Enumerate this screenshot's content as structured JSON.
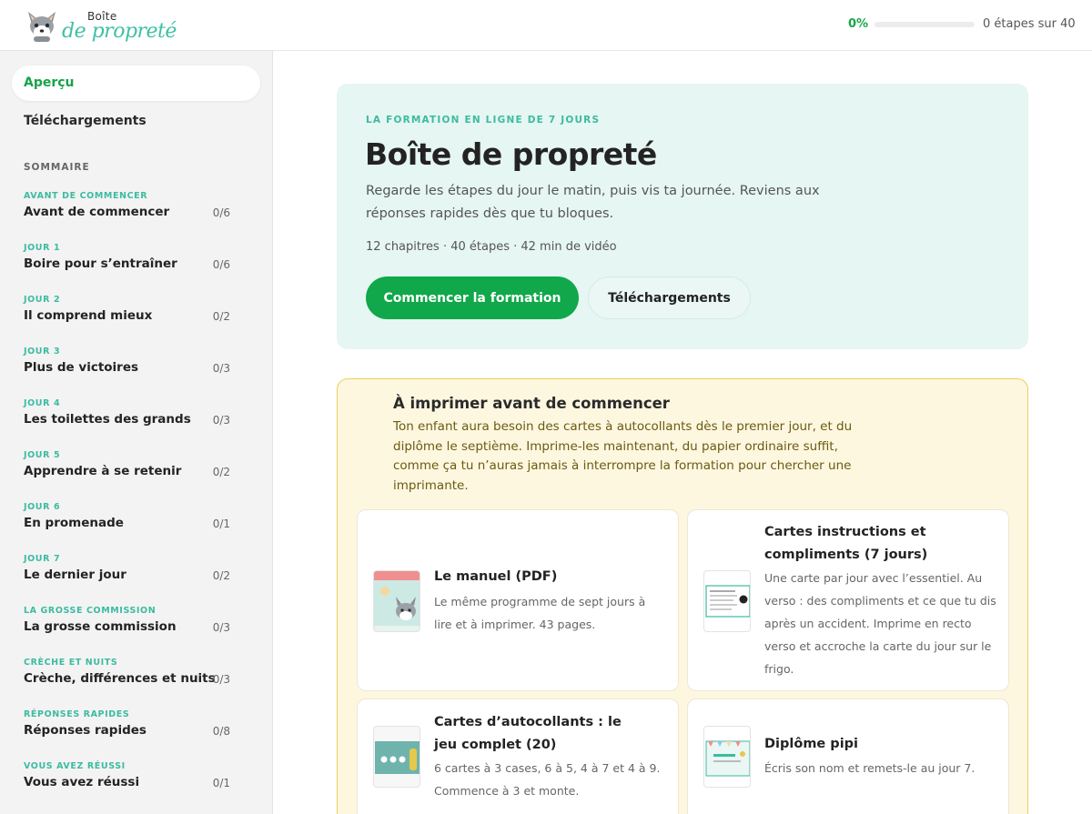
{
  "header": {
    "logo_small": "Boîte",
    "logo_big": "de propreté",
    "progress_percent": "0%",
    "progress_fraction": 0,
    "progress_text": "0 étapes sur 40"
  },
  "sidebar": {
    "active_item": "Aperçu",
    "downloads_link": "Téléchargements",
    "sommaire_label": "SOMMAIRE",
    "chapters": [
      {
        "label": "AVANT DE COMMENCER",
        "title": "Avant de commencer",
        "count": "0/6"
      },
      {
        "label": "JOUR 1",
        "title": "Boire pour s’entraîner",
        "count": "0/6"
      },
      {
        "label": "JOUR 2",
        "title": "Il comprend mieux",
        "count": "0/2"
      },
      {
        "label": "JOUR 3",
        "title": "Plus de victoires",
        "count": "0/3"
      },
      {
        "label": "JOUR 4",
        "title": "Les toilettes des grands",
        "count": "0/3"
      },
      {
        "label": "JOUR 5",
        "title": "Apprendre à se retenir",
        "count": "0/2"
      },
      {
        "label": "JOUR 6",
        "title": "En promenade",
        "count": "0/1"
      },
      {
        "label": "JOUR 7",
        "title": "Le dernier jour",
        "count": "0/2"
      },
      {
        "label": "LA GROSSE COMMISSION",
        "title": "La grosse commission",
        "count": "0/3"
      },
      {
        "label": "CRÈCHE ET NUITS",
        "title": "Crèche, différences et nuits",
        "count": "0/3"
      },
      {
        "label": "RÉPONSES RAPIDES",
        "title": "Réponses rapides",
        "count": "0/8"
      },
      {
        "label": "VOUS AVEZ RÉUSSI",
        "title": "Vous avez réussi",
        "count": "0/1"
      }
    ]
  },
  "hero": {
    "eyebrow": "LA FORMATION EN LIGNE DE 7 JOURS",
    "title": "Boîte de propreté",
    "description": "Regarde les étapes du jour le matin, puis vis ta journée. Reviens aux réponses rapides dès que tu bloques.",
    "meta": "12 chapitres · 40 étapes · 42 min de vidéo",
    "primary_button": "Commencer la formation",
    "secondary_button": "Téléchargements"
  },
  "print_box": {
    "title": "À imprimer avant de commencer",
    "description": "Ton enfant aura besoin des cartes à autocollants dès le premier jour, et du diplôme le septième. Imprime-les maintenant, du papier ordinaire suffit, comme ça tu n’auras jamais à interrompre la formation pour chercher une imprimante.",
    "cards": [
      {
        "title": "Le manuel (PDF)",
        "description": "Le même programme de sept jours à lire et à imprimer. 43 pages."
      },
      {
        "title": "Cartes instructions et compliments (7 jours)",
        "description": "Une carte par jour avec l’essentiel. Au verso : des compliments et ce que tu dis après un accident. Imprime en recto verso et accroche la carte du jour sur le frigo."
      },
      {
        "title": "Cartes d’autocollants : le jeu complet (20)",
        "description": "6 cartes à 3 cases, 6 à 5, 4 à 7 et 4 à 9. Commence à 3 et monte."
      },
      {
        "title": "Diplôme pipi",
        "description": "Écris son nom et remets-le au jour 7."
      }
    ]
  },
  "colors": {
    "accent_green": "#10a84a",
    "teal": "#3cbba1",
    "hero_bg": "#e6f6f2",
    "print_bg": "#fdf7e0",
    "print_border": "#e9cf5c"
  },
  "icons": {
    "logo": "fox-icon"
  }
}
